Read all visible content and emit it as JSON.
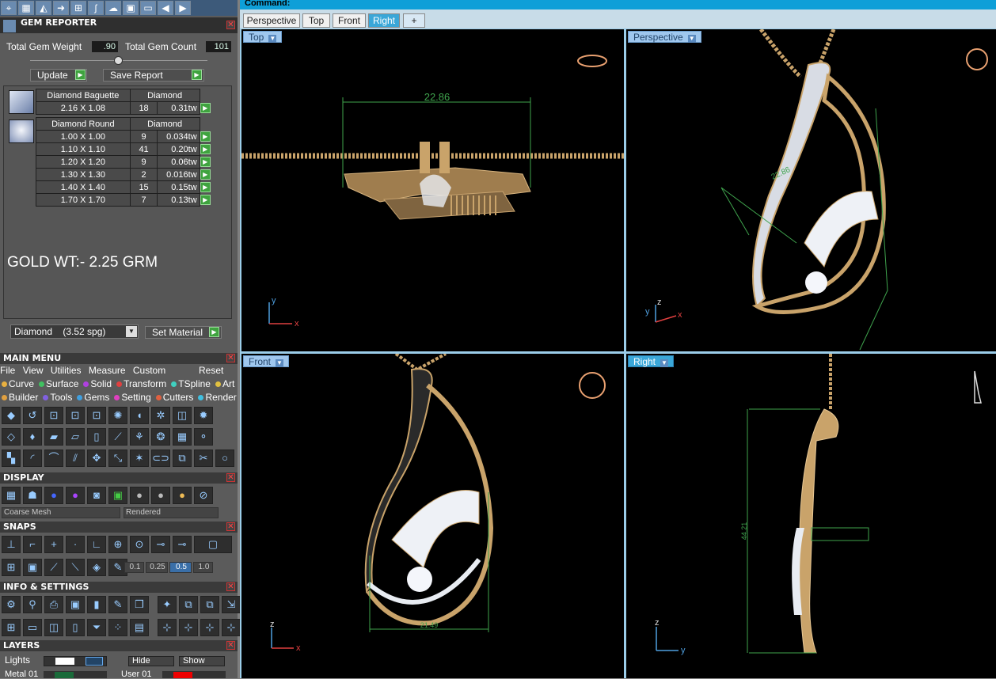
{
  "command": "Command:",
  "view_tabs": [
    "Perspective",
    "Top",
    "Front",
    "Right",
    "+"
  ],
  "viewports": {
    "top": {
      "label": "Top",
      "dim": "22.86"
    },
    "perspective": {
      "label": "Perspective",
      "dim": "22.86"
    },
    "front": {
      "label": "Front",
      "dim": "21.49"
    },
    "right": {
      "label": "Right",
      "dim": "44.21"
    }
  },
  "axes": {
    "x": "x",
    "y": "y",
    "z": "z"
  },
  "gem_reporter": {
    "title": "GEM REPORTER",
    "weight_label": "Total Gem Weight",
    "weight_value": ".90",
    "count_label": "Total Gem Count",
    "count_value": "101",
    "update": "Update",
    "save_report": "Save Report",
    "groups": [
      {
        "name": "Diamond Baguette",
        "material": "Diamond",
        "rows": [
          [
            "2.16 X 1.08",
            "18",
            "0.31tw"
          ]
        ]
      },
      {
        "name": "Diamond Round",
        "material": "Diamond",
        "rows": [
          [
            "1.00 X 1.00",
            "9",
            "0.034tw"
          ],
          [
            "1.10 X 1.10",
            "41",
            "0.20tw"
          ],
          [
            "1.20 X 1.20",
            "9",
            "0.06tw"
          ],
          [
            "1.30 X 1.30",
            "2",
            "0.016tw"
          ],
          [
            "1.40 X 1.40",
            "15",
            "0.15tw"
          ],
          [
            "1.70 X 1.70",
            "7",
            "0.13tw"
          ]
        ]
      }
    ],
    "gold_wt": "GOLD WT:- 2.25 GRM",
    "material_select": "Diamond    (3.52 spg)",
    "set_material": "Set Material"
  },
  "main_menu": {
    "title": "MAIN MENU",
    "menus": [
      "File",
      "View",
      "Utilities",
      "Measure",
      "Custom"
    ],
    "reset": "Reset",
    "row1": [
      {
        "label": "Curve",
        "color": "#e8b040"
      },
      {
        "label": "Surface",
        "color": "#40c060"
      },
      {
        "label": "Solid",
        "color": "#b040e0"
      },
      {
        "label": "Transform",
        "color": "#e04040"
      },
      {
        "label": "TSpline",
        "color": "#40d0c0"
      },
      {
        "label": "Art",
        "color": "#e0c040"
      }
    ],
    "row2": [
      {
        "label": "Builder",
        "color": "#e0a040"
      },
      {
        "label": "Tools",
        "color": "#8060e0"
      },
      {
        "label": "Gems",
        "color": "#40a0e0"
      },
      {
        "label": "Setting",
        "color": "#e040c0"
      },
      {
        "label": "Cutters",
        "color": "#e06040"
      },
      {
        "label": "Render",
        "color": "#40c0e0"
      }
    ]
  },
  "display": {
    "title": "DISPLAY",
    "mesh": "Coarse Mesh",
    "render": "Rendered"
  },
  "snaps": {
    "title": "SNAPS",
    "values": [
      "0.1",
      "0.25",
      "0.5",
      "1.0"
    ]
  },
  "info": {
    "title": "INFO & SETTINGS"
  },
  "layers": {
    "title": "LAYERS",
    "lights": "Lights",
    "hide": "Hide",
    "show": "Show",
    "metal": "Metal 01",
    "user": "User 01"
  },
  "colors": {
    "gold": "#c9a36a",
    "diamond": "#e8ecf2",
    "dim_line": "#3fa34d",
    "cmd_bar": "#0e9fd8"
  }
}
